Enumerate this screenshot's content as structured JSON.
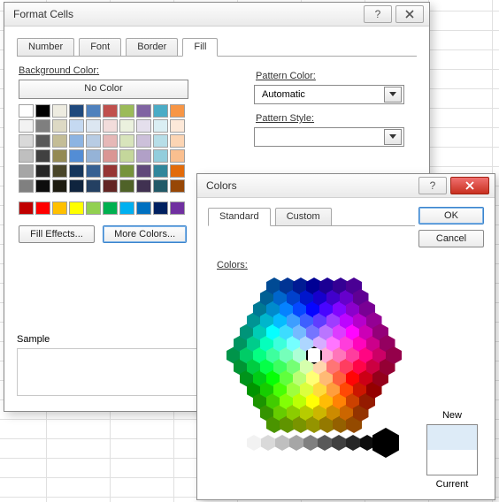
{
  "format_cells": {
    "title": "Format Cells",
    "tabs": [
      "Number",
      "Font",
      "Border",
      "Fill"
    ],
    "active_tab": 3,
    "bg_label": "Background Color:",
    "no_color": "No Color",
    "fill_effects": "Fill Effects...",
    "more_colors": "More Colors...",
    "sample_label": "Sample",
    "pattern_color_label": "Pattern Color:",
    "pattern_color_value": "Automatic",
    "pattern_style_label": "Pattern Style:",
    "theme_rows": [
      [
        "#FFFFFF",
        "#000000",
        "#EEECE1",
        "#1F497D",
        "#4F81BD",
        "#C0504D",
        "#9BBB59",
        "#8064A2",
        "#4BACC6",
        "#F79646"
      ],
      [
        "#F2F2F2",
        "#7F7F7F",
        "#DDD9C4",
        "#C5D9F1",
        "#DCE6F1",
        "#F2DCDB",
        "#EBF1DE",
        "#E4DFEC",
        "#DAEEF3",
        "#FDE9D9"
      ],
      [
        "#D9D9D9",
        "#595959",
        "#C4BD97",
        "#8DB4E2",
        "#B8CCE4",
        "#E6B8B7",
        "#D8E4BC",
        "#CCC0DA",
        "#B7DEE8",
        "#FCD5B4"
      ],
      [
        "#BFBFBF",
        "#404040",
        "#948A54",
        "#538DD5",
        "#95B3D7",
        "#DA9694",
        "#C4D79B",
        "#B1A0C7",
        "#92CDDC",
        "#FABF8F"
      ],
      [
        "#A6A6A6",
        "#262626",
        "#494529",
        "#16365C",
        "#366092",
        "#963634",
        "#76933C",
        "#60497A",
        "#31869B",
        "#E26B0A"
      ],
      [
        "#808080",
        "#0D0D0D",
        "#1D1B10",
        "#0F243E",
        "#244062",
        "#632523",
        "#4F6228",
        "#403151",
        "#215967",
        "#974706"
      ]
    ],
    "standard_row": [
      "#C00000",
      "#FF0000",
      "#FFC000",
      "#FFFF00",
      "#92D050",
      "#00B050",
      "#00B0F0",
      "#0070C0",
      "#002060",
      "#7030A0"
    ]
  },
  "colors": {
    "title": "Colors",
    "tabs": [
      "Standard",
      "Custom"
    ],
    "active_tab": 0,
    "colors_label": "Colors:",
    "ok": "OK",
    "cancel": "Cancel",
    "new_label": "New",
    "current_label": "Current",
    "new_color": "#DDEBF7",
    "current_color": "#FFFFFF",
    "greys": [
      "#FFFFFF",
      "#F2F2F2",
      "#D9D9D9",
      "#BFBFBF",
      "#A6A6A6",
      "#808080",
      "#595959",
      "#404040",
      "#262626",
      "#0D0D0D"
    ]
  }
}
